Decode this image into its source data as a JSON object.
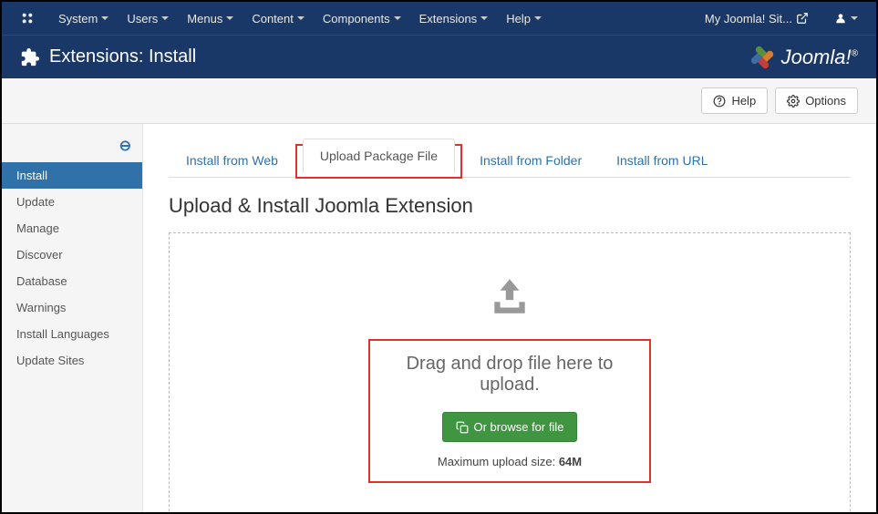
{
  "topnav": {
    "items": [
      "System",
      "Users",
      "Menus",
      "Content",
      "Components",
      "Extensions",
      "Help"
    ],
    "site_name": "My Joomla! Sit..."
  },
  "header": {
    "title": "Extensions: Install",
    "brand": "Joomla!"
  },
  "toolbar": {
    "help": "Help",
    "options": "Options"
  },
  "sidebar": {
    "items": [
      "Install",
      "Update",
      "Manage",
      "Discover",
      "Database",
      "Warnings",
      "Install Languages",
      "Update Sites"
    ],
    "active_index": 0
  },
  "tabs": {
    "items": [
      "Install from Web",
      "Upload Package File",
      "Install from Folder",
      "Install from URL"
    ],
    "active_index": 1
  },
  "main": {
    "heading": "Upload & Install Joomla Extension",
    "drop_text": "Drag and drop file here to upload.",
    "browse_btn": "Or browse for file",
    "max_label": "Maximum upload size: ",
    "max_value": "64M"
  }
}
